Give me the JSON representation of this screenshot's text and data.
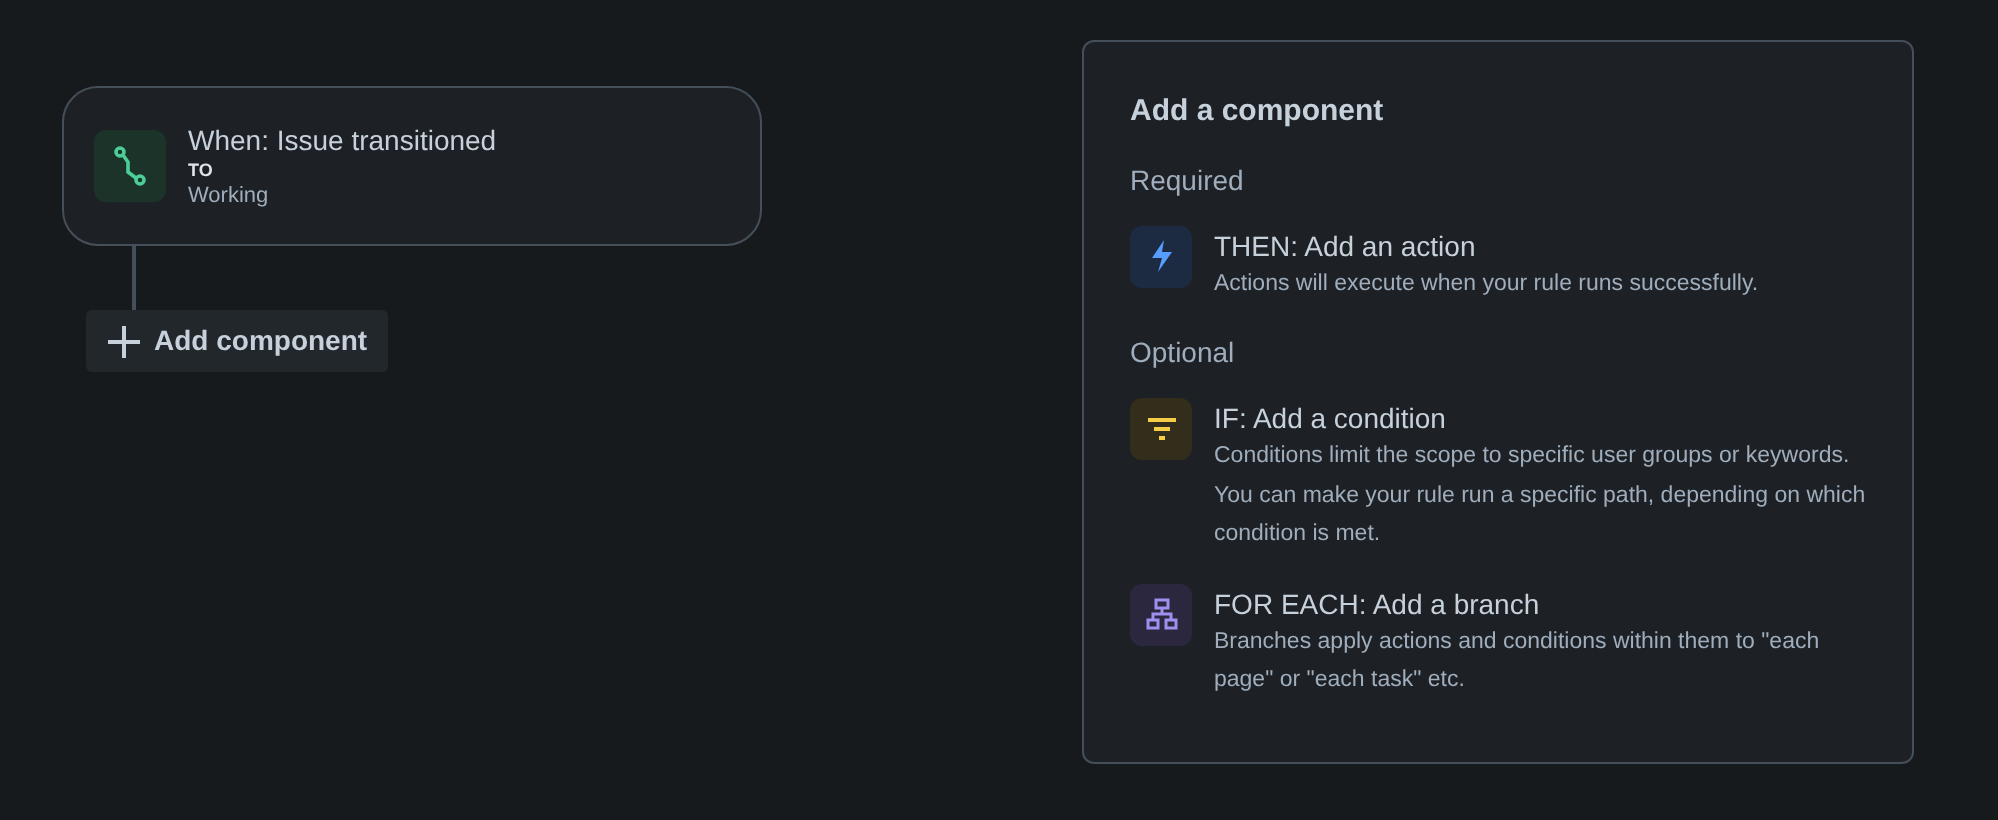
{
  "trigger": {
    "kind": "transition",
    "title": "When: Issue transitioned",
    "label": "TO",
    "value": "Working"
  },
  "add_button": {
    "label": "Add component"
  },
  "panel": {
    "title": "Add a component",
    "sections": [
      {
        "heading": "Required",
        "items": [
          {
            "kind": "action",
            "title": "THEN: Add an action",
            "description": "Actions will execute when your rule runs successfully."
          }
        ]
      },
      {
        "heading": "Optional",
        "items": [
          {
            "kind": "condition",
            "title": "IF: Add a condition",
            "description": "Conditions limit the scope to specific user groups or keywords. You can make your rule run a specific path, depending on which condition is met."
          },
          {
            "kind": "branch",
            "title": "FOR EACH: Add a branch",
            "description": "Branches apply actions and conditions within them to \"each page\" or \"each task\" etc."
          }
        ]
      }
    ]
  }
}
